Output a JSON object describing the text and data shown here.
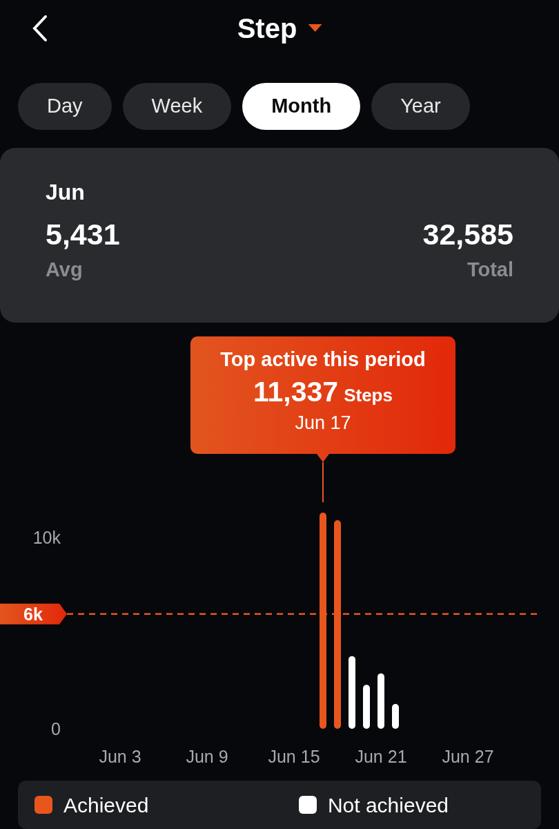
{
  "header": {
    "title": "Step"
  },
  "tabs": [
    {
      "label": "Day",
      "selected": false
    },
    {
      "label": "Week",
      "selected": false
    },
    {
      "label": "Month",
      "selected": true
    },
    {
      "label": "Year",
      "selected": false
    }
  ],
  "summary": {
    "period": "Jun",
    "average": {
      "value": "5,431",
      "label": "Avg"
    },
    "total": {
      "value": "32,585",
      "label": "Total"
    }
  },
  "chart": {
    "tooltip": {
      "title": "Top active this period",
      "value": "11,337",
      "unit": "Steps",
      "date": "Jun 17"
    },
    "chart_data": {
      "type": "bar",
      "categories": [
        null,
        null,
        "Jun 3",
        null,
        null,
        null,
        null,
        null,
        "Jun 9",
        null,
        null,
        null,
        null,
        null,
        "Jun 15",
        null,
        null,
        null,
        null,
        null,
        "Jun 21",
        null,
        null,
        null,
        null,
        null,
        "Jun 27",
        null,
        null,
        null
      ],
      "series": [
        {
          "name": "Achieved",
          "color": "#e8561e",
          "values": [
            null,
            null,
            null,
            null,
            null,
            null,
            null,
            null,
            null,
            null,
            null,
            null,
            null,
            null,
            null,
            null,
            11300,
            10900,
            null,
            null,
            null,
            null,
            null,
            null,
            null,
            null,
            null,
            null,
            null,
            null
          ]
        },
        {
          "name": "Not achieved",
          "color": "#ffffff",
          "values": [
            null,
            null,
            null,
            null,
            null,
            null,
            null,
            null,
            null,
            null,
            null,
            null,
            null,
            null,
            null,
            null,
            null,
            null,
            3800,
            2300,
            2900,
            1300,
            null,
            null,
            null,
            null,
            null,
            null,
            null,
            null
          ]
        }
      ],
      "ylim": [
        0,
        11300
      ],
      "yticks": [
        0,
        {
          "value": 10000,
          "label": "10k"
        }
      ],
      "ref_lines": [
        {
          "axis": "y",
          "value": 6000,
          "label": "6k"
        }
      ]
    }
  }
}
